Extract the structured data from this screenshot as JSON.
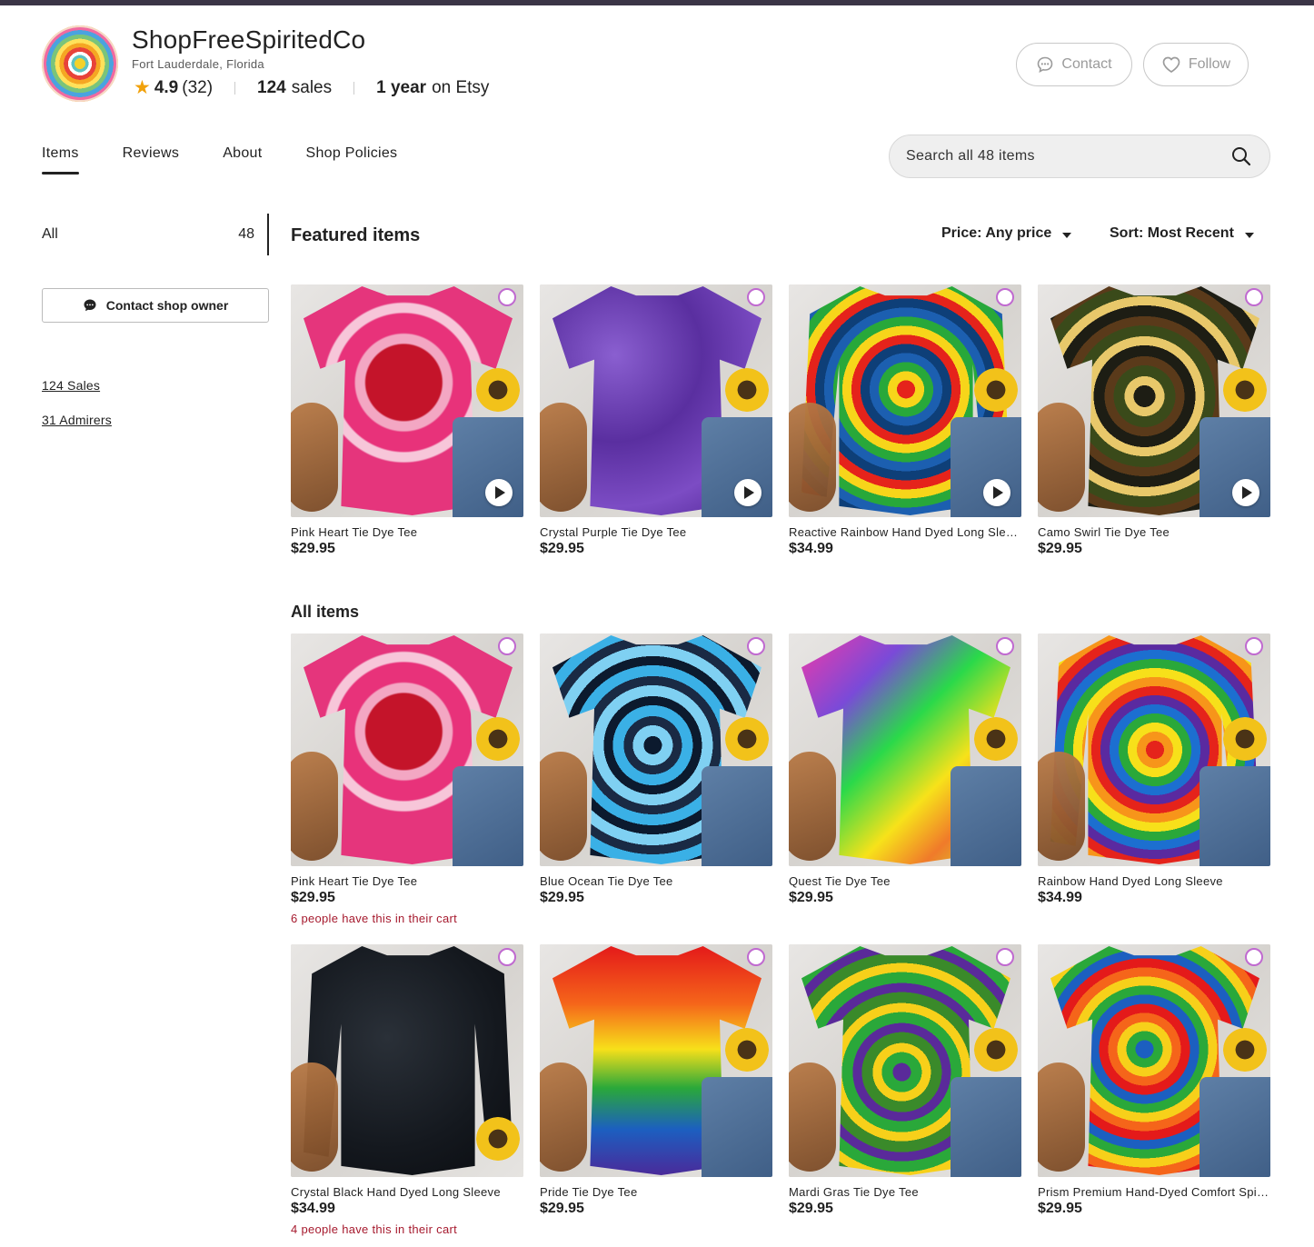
{
  "shop": {
    "name": "ShopFreeSpiritedCo",
    "location": "Fort Lauderdale, Florida",
    "rating": "4.9",
    "rating_count": "(32)",
    "sales_count": "124",
    "sales_label": "sales",
    "years_count": "1 year",
    "years_label": "on Etsy",
    "contact_label": "Contact",
    "follow_label": "Follow"
  },
  "tabs": [
    {
      "label": "Items"
    },
    {
      "label": "Reviews"
    },
    {
      "label": "About"
    },
    {
      "label": "Shop Policies"
    }
  ],
  "search": {
    "placeholder": "Search all 48 items"
  },
  "sidebar": {
    "all_label": "All",
    "all_count": "48",
    "contact_owner_label": "Contact shop owner",
    "sales_link": "124 Sales",
    "admirers_link": "31 Admirers"
  },
  "featured": {
    "title": "Featured items",
    "price_filter": "Price: Any price",
    "sort_filter": "Sort: Most Recent",
    "items": [
      {
        "title": "Pink Heart Tie Dye Tee",
        "price": "$29.95"
      },
      {
        "title": "Crystal Purple Tie Dye Tee",
        "price": "$29.95"
      },
      {
        "title": "Reactive Rainbow Hand Dyed Long Sleeve",
        "price": "$34.99"
      },
      {
        "title": "Camo Swirl Tie Dye Tee",
        "price": "$29.95"
      }
    ]
  },
  "all_items": {
    "title": "All items",
    "items": [
      {
        "title": "Pink Heart Tie Dye Tee",
        "price": "$29.95",
        "note": "6 people have this in their cart"
      },
      {
        "title": "Blue Ocean Tie Dye Tee",
        "price": "$29.95",
        "note": ""
      },
      {
        "title": "Quest Tie Dye Tee",
        "price": "$29.95",
        "note": ""
      },
      {
        "title": "Rainbow Hand Dyed Long Sleeve",
        "price": "$34.99",
        "note": ""
      },
      {
        "title": "Crystal Black Hand Dyed Long Sleeve",
        "price": "$34.99",
        "note": "4 people have this in their cart"
      },
      {
        "title": "Pride Tie Dye Tee",
        "price": "$29.95",
        "note": ""
      },
      {
        "title": "Mardi Gras Tie Dye Tee",
        "price": "$29.95",
        "note": ""
      },
      {
        "title": "Prism Premium Hand-Dyed Comfort Spiral Tee",
        "price": "$29.95",
        "note": ""
      }
    ]
  },
  "colors": {
    "accent_dark": "#222222",
    "star": "#f1a10a",
    "cart_note": "#a61a2e",
    "top_bar": "#3b3546"
  }
}
